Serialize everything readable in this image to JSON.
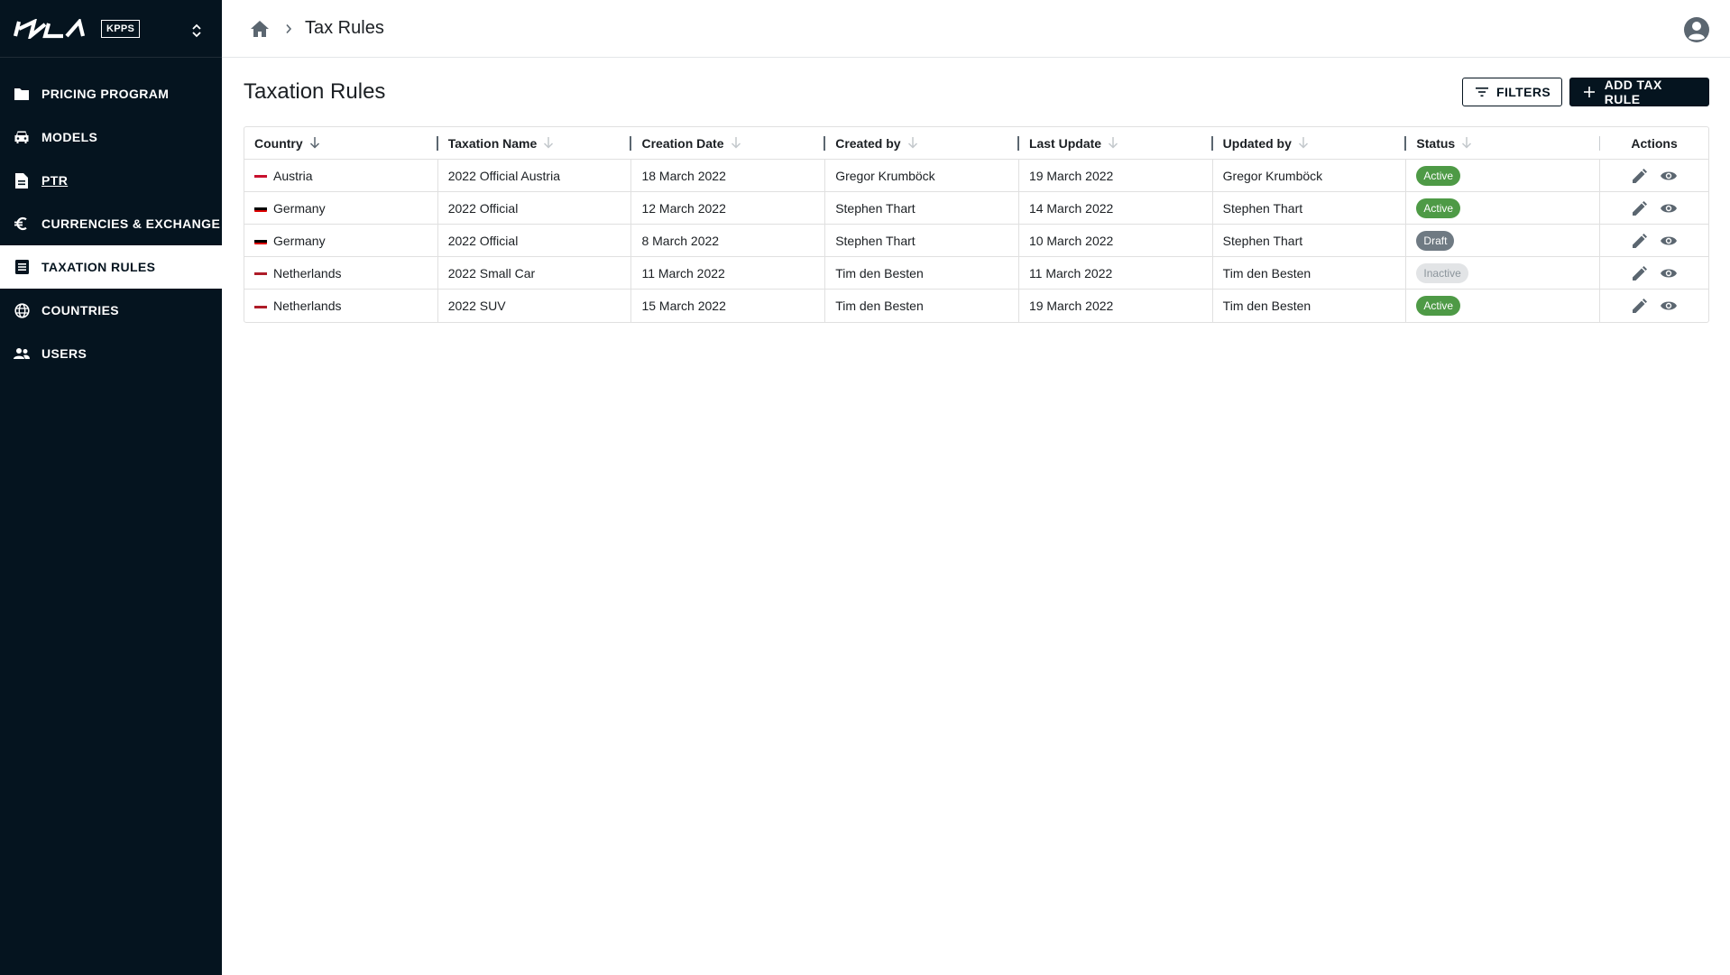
{
  "brand": {
    "logo_text": "KIA",
    "badge": "KPPS"
  },
  "sidebar": {
    "items": [
      {
        "label": "PRICING PROGRAM",
        "icon": "folder-icon"
      },
      {
        "label": "MODELS",
        "icon": "car-icon"
      },
      {
        "label": "PTR",
        "icon": "document-icon"
      },
      {
        "label": "CURRENCIES & EXCHANGE",
        "icon": "euro-icon"
      },
      {
        "label": "TAXATION RULES",
        "icon": "list-icon"
      },
      {
        "label": "COUNTRIES",
        "icon": "globe-icon"
      },
      {
        "label": "USERS",
        "icon": "users-icon"
      }
    ],
    "active_index": 4
  },
  "breadcrumb": {
    "current": "Tax Rules"
  },
  "page": {
    "title": "Taxation Rules"
  },
  "toolbar": {
    "filters_label": "FILTERS",
    "add_label": "ADD TAX RULE"
  },
  "table": {
    "columns": [
      "Country",
      "Taxation Name",
      "Creation Date",
      "Created by",
      "Last Update",
      "Updated by",
      "Status",
      "Actions"
    ],
    "rows": [
      {
        "country": "Austria",
        "flag": "austria",
        "name": "2022 Official Austria",
        "created": "18 March 2022",
        "created_by": "Gregor Krumböck",
        "updated": "19 March 2022",
        "updated_by": "Gregor Krumböck",
        "status": "Active"
      },
      {
        "country": "Germany",
        "flag": "germany",
        "name": "2022 Official",
        "created": "12 March 2022",
        "created_by": "Stephen Thart",
        "updated": "14 March 2022",
        "updated_by": "Stephen Thart",
        "status": "Active"
      },
      {
        "country": "Germany",
        "flag": "germany",
        "name": "2022 Official",
        "created": "8 March 2022",
        "created_by": "Stephen Thart",
        "updated": "10 March 2022",
        "updated_by": "Stephen Thart",
        "status": "Draft"
      },
      {
        "country": "Netherlands",
        "flag": "netherlands",
        "name": "2022 Small Car",
        "created": "11 March 2022",
        "created_by": "Tim den Besten",
        "updated": "11 March 2022",
        "updated_by": "Tim den Besten",
        "status": "Inactive"
      },
      {
        "country": "Netherlands",
        "flag": "netherlands",
        "name": "2022 SUV",
        "created": "15 March 2022",
        "created_by": "Tim den Besten",
        "updated": "19 March 2022",
        "updated_by": "Tim den Besten",
        "status": "Active"
      }
    ]
  },
  "colors": {
    "sidebar_bg": "#05141f",
    "active_status": "#4e9a46",
    "draft_status": "#6f7a83",
    "inactive_status": "#e2e4e6"
  }
}
